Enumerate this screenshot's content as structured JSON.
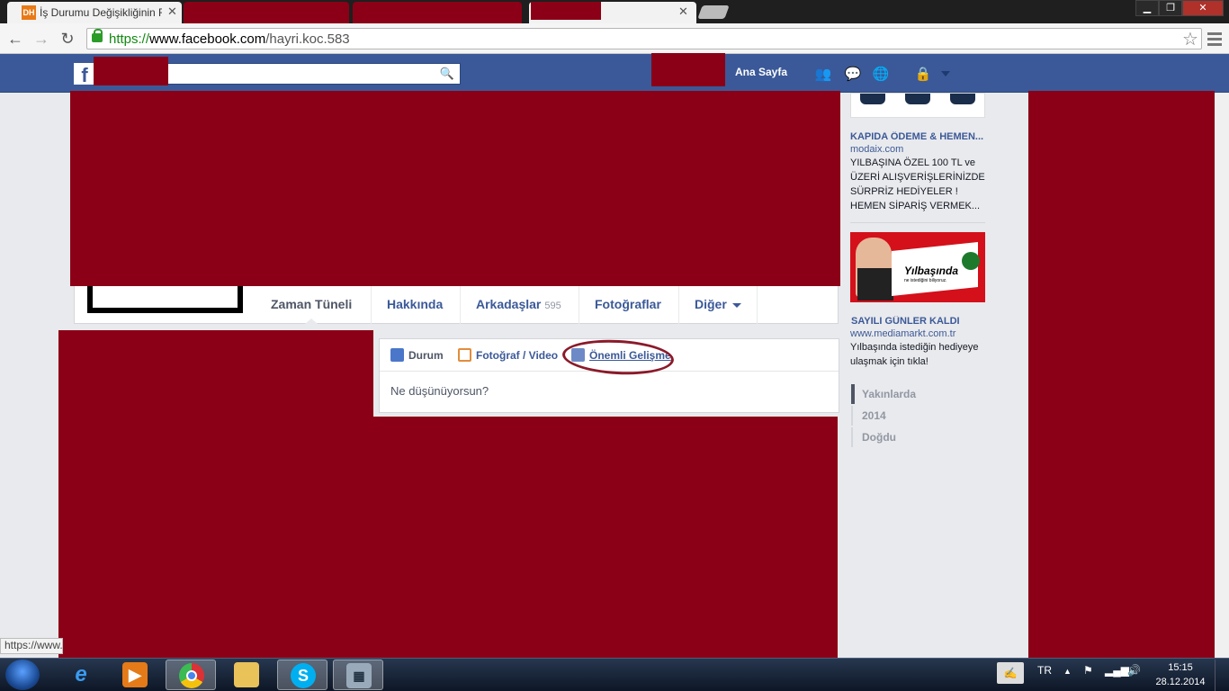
{
  "browser": {
    "active_tab_title": "İş Durumu Değişikliğinin F",
    "tab_favicon_text": "DH",
    "url_https": "https://",
    "url_host": "www.facebook.com",
    "url_path": "/hayri.koc.583",
    "status_text": "https://www."
  },
  "fb_header": {
    "home_label": "Ana Sayfa"
  },
  "profile_nav": {
    "tabs": [
      {
        "label": "Zaman Tüneli"
      },
      {
        "label": "Hakkında"
      },
      {
        "label": "Arkadaşlar",
        "count": "595"
      },
      {
        "label": "Fotoğraflar"
      },
      {
        "label": "Diğer"
      }
    ]
  },
  "composer": {
    "tabs": [
      "Durum",
      "Fotoğraf / Video",
      "Önemli Gelişme"
    ],
    "placeholder": "Ne düşünüyorsun?"
  },
  "ads": [
    {
      "title": "KAPIDA ÖDEME & HEMEN...",
      "domain": "modaix.com",
      "body": "YILBAŞINA ÖZEL 100 TL ve ÜZERİ ALIŞVERİŞLERİNİZDE SÜRPRİZ HEDİYELER ! HEMEN SİPARİŞ VERMEK..."
    },
    {
      "image_text": "Yılbaşında",
      "image_subtext": "ne istediğini biliyoruz.",
      "title": "SAYILI GÜNLER KALDI",
      "domain": "www.mediamarkt.com.tr",
      "body": "Yılbaşında istediğin hediyeye ulaşmak için tıkla!"
    }
  ],
  "timeline_years": [
    "Yakınlarda",
    "2014",
    "Doğdu"
  ],
  "taskbar": {
    "language": "TR",
    "time": "15:15",
    "date": "28.12.2014"
  },
  "colors": {
    "facebook_blue": "#3b5998",
    "redaction": "#8b0016",
    "annotation_circle": "#8b1a2a"
  }
}
